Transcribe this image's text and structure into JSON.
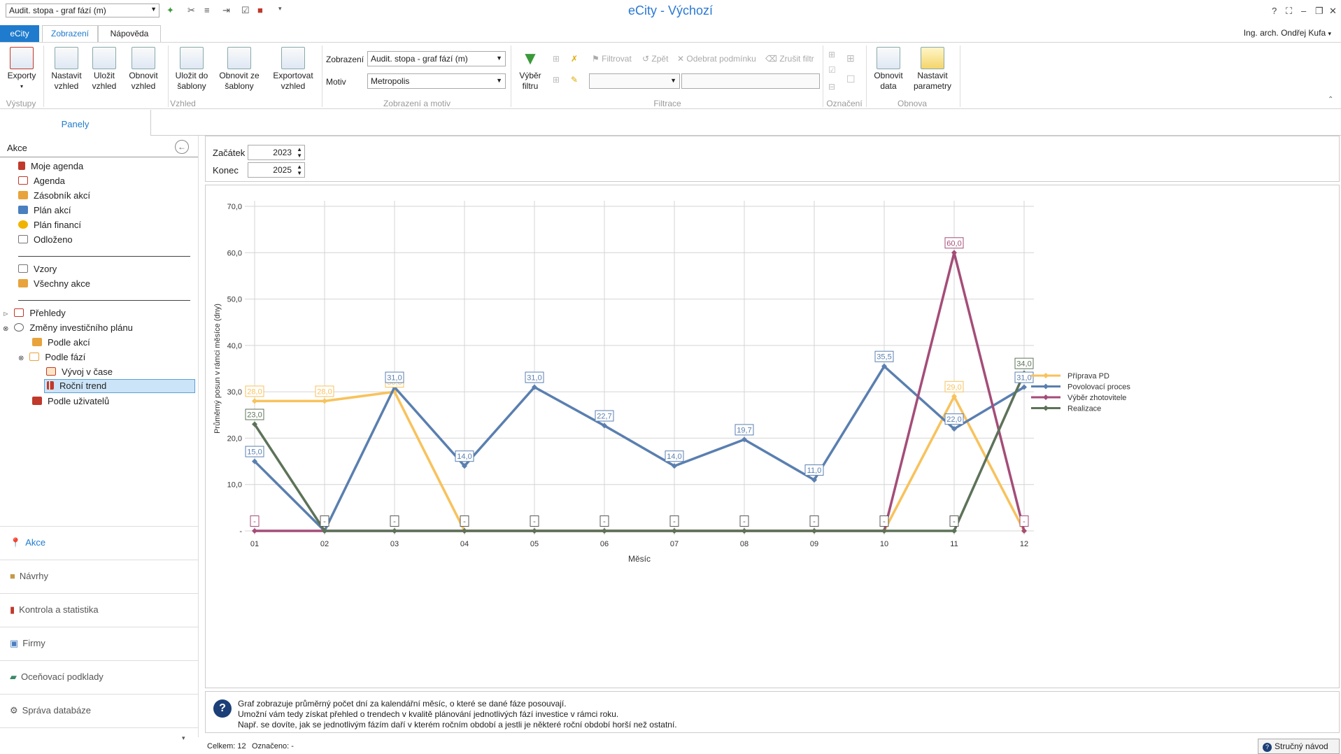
{
  "app": {
    "title": "eCity - Výchozí",
    "user": "Ing. arch. Ondřej Kufa"
  },
  "qat": {
    "combo": "Audit. stopa - graf fází (m)"
  },
  "window": {
    "help": "?",
    "min": "–",
    "max": "❐",
    "close": "✕"
  },
  "tabs": [
    {
      "label": "eCity"
    },
    {
      "label": "Zobrazení"
    },
    {
      "label": "Nápověda"
    }
  ],
  "ribbon": {
    "exports": "Exporty",
    "set_view_1": "Nastavit",
    "set_view_2": "vzhled",
    "save_view_1": "Uložit",
    "save_view_2": "vzhled",
    "refresh_view_1": "Obnovit",
    "refresh_view_2": "vzhled",
    "save_tpl_1": "Uložit do",
    "save_tpl_2": "šablony",
    "refresh_tpl_1": "Obnovit ze",
    "refresh_tpl_2": "šablony",
    "export_view_1": "Exportovat",
    "export_view_2": "vzhled",
    "display_label": "Zobrazení",
    "display_value": "Audit. stopa - graf fází (m)",
    "motiv_label": "Motiv",
    "motiv_value": "Metropolis",
    "filter_select_1": "Výběr",
    "filter_select_2": "filtru",
    "filter": "Filtrovat",
    "back": "Zpět",
    "remove_cond": "Odebrat podmínku",
    "cancel_filter": "Zrušit filtr",
    "refresh_data_1": "Obnovit",
    "refresh_data_2": "data",
    "set_params_1": "Nastavit",
    "set_params_2": "parametry",
    "groups": {
      "outputs": "Výstupy",
      "look": "Vzhled",
      "display_motiv": "Zobrazení a motiv",
      "filtration": "Filtrace",
      "marking": "Označení",
      "refresh": "Obnova"
    }
  },
  "left": {
    "panels_tab": "Panely",
    "akce_header": "Akce",
    "items": [
      "Moje agenda",
      "Agenda",
      "Zásobník akcí",
      "Plán akcí",
      "Plán financí",
      "Odloženo"
    ],
    "items2": [
      "Vzory",
      "Všechny akce"
    ],
    "tree": {
      "prehledy": "Přehledy",
      "zmeny": "Změny investičního plánu",
      "podle_akci": "Podle akcí",
      "podle_fazi": "Podle fází",
      "vyvoj": "Vývoj v čase",
      "rocni": "Roční trend",
      "podle_uziv": "Podle uživatelů"
    },
    "nav": [
      "Akce",
      "Návrhy",
      "Kontrola a statistika",
      "Firmy",
      "Oceňovací podklady",
      "Správa databáze"
    ]
  },
  "range": {
    "start_label": "Začátek",
    "start_value": "2023",
    "end_label": "Konec",
    "end_value": "2025"
  },
  "chart_data": {
    "type": "line",
    "xlabel": "Měsíc",
    "ylabel": "Průměrný posun v rámci měsíce (dny)",
    "ylim": [
      0,
      70
    ],
    "yticks": [
      "-",
      "10,0",
      "20,0",
      "30,0",
      "40,0",
      "50,0",
      "60,0",
      "70,0"
    ],
    "categories": [
      "01",
      "02",
      "03",
      "04",
      "05",
      "06",
      "07",
      "08",
      "09",
      "10",
      "11",
      "12"
    ],
    "legend_position": "right",
    "grid": true,
    "series": [
      {
        "name": "Příprava PD",
        "color": "#f8c25c",
        "values": [
          28,
          28,
          30,
          0,
          0,
          0,
          0,
          0,
          0,
          0,
          29,
          0
        ],
        "labels": [
          "28,0",
          "28,0",
          "30,0",
          "",
          "",
          "",
          "",
          "",
          "",
          "",
          "29,0",
          ""
        ]
      },
      {
        "name": "Povolovací proces",
        "color": "#5a7fb0",
        "values": [
          15,
          0,
          31,
          14,
          31,
          22.7,
          14,
          19.7,
          11,
          35.5,
          22,
          31
        ],
        "labels": [
          "15,0",
          "-",
          "31,0",
          "14,0",
          "31,0",
          "22,7",
          "14,0",
          "19,7",
          "11,0",
          "35,5",
          "22,0",
          "31,0"
        ]
      },
      {
        "name": "Výběr zhotovitele",
        "color": "#a44d78",
        "values": [
          0,
          0,
          0,
          0,
          0,
          0,
          0,
          0,
          0,
          0,
          60,
          0
        ],
        "labels": [
          "-",
          "",
          "",
          "",
          "",
          "",
          "",
          "",
          "",
          "",
          "60,0",
          "-"
        ]
      },
      {
        "name": "Realizace",
        "color": "#5d7359",
        "values": [
          23,
          0,
          0,
          0,
          0,
          0,
          0,
          0,
          0,
          0,
          0,
          34
        ],
        "labels": [
          "23,0",
          "",
          "",
          "",
          "",
          "",
          "",
          "",
          "",
          "",
          "",
          "34,0"
        ]
      }
    ],
    "zero_markers": [
      "",
      "-",
      "-",
      "-",
      "-",
      "-",
      "-",
      "-",
      "-",
      "-",
      "-",
      ""
    ]
  },
  "info": {
    "line1": "Graf zobrazuje průměrný počet dní za kalendářní měsíc, o které se dané fáze posouvají.",
    "line2": "Umožní vám tedy získat přehled o trendech v kvalitě plánování jednotlivých fází investice v rámci roku.",
    "line3": "Např. se dovíte, jak se jednotlivým fázím daří v kterém ročním období a jestli je některé roční období horší než ostatní."
  },
  "status": {
    "total": "Celkem: 12",
    "marked": "Označeno: -",
    "guide": "Stručný návod"
  }
}
